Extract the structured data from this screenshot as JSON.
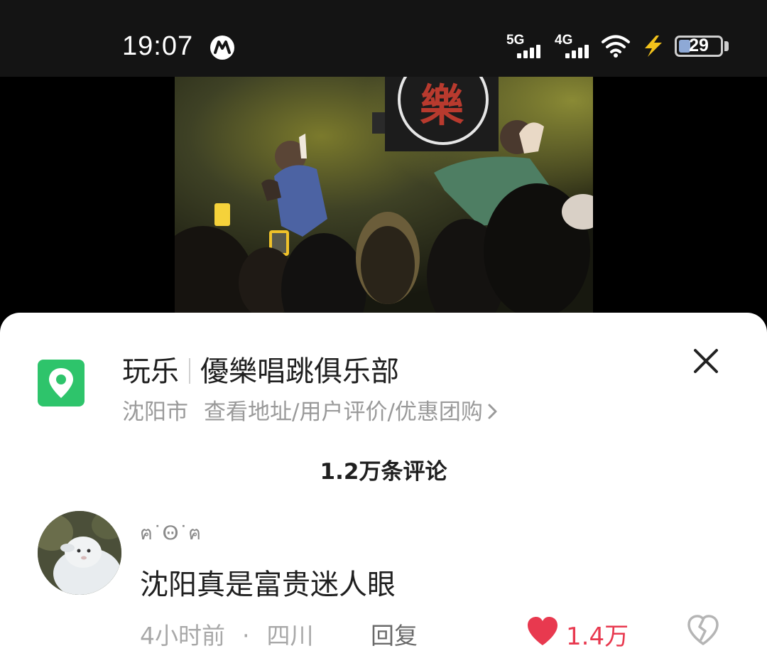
{
  "status_bar": {
    "time": "19:07",
    "network_1": "5G",
    "network_2": "4G",
    "battery": "29",
    "battery_level": 0.29
  },
  "icons": [
    "metro-icon",
    "signal-icon",
    "wifi-icon",
    "lightning-icon",
    "battery-icon",
    "location-pin-icon",
    "close-icon",
    "chevron-right-icon",
    "heart-icon",
    "broken-heart-icon"
  ],
  "colors": {
    "poi_green": "#2ec46b",
    "like_red": "#e8394f",
    "video_sign_red": "#b83a2e"
  },
  "video": {
    "sign_text": "樂"
  },
  "poi": {
    "category": "玩乐",
    "name": "優樂唱跳俱乐部",
    "city": "沈阳市",
    "link_text": "查看地址/用户评价/优惠团购"
  },
  "comments_header": "1.2万条评论",
  "comment": {
    "username": "ฅ˙Ꙫ˙ฅ",
    "text": "沈阳真是富贵迷人眼",
    "time": "4小时前",
    "dot": "·",
    "location": "四川",
    "reply_label": "回复",
    "likes": "1.4万"
  }
}
